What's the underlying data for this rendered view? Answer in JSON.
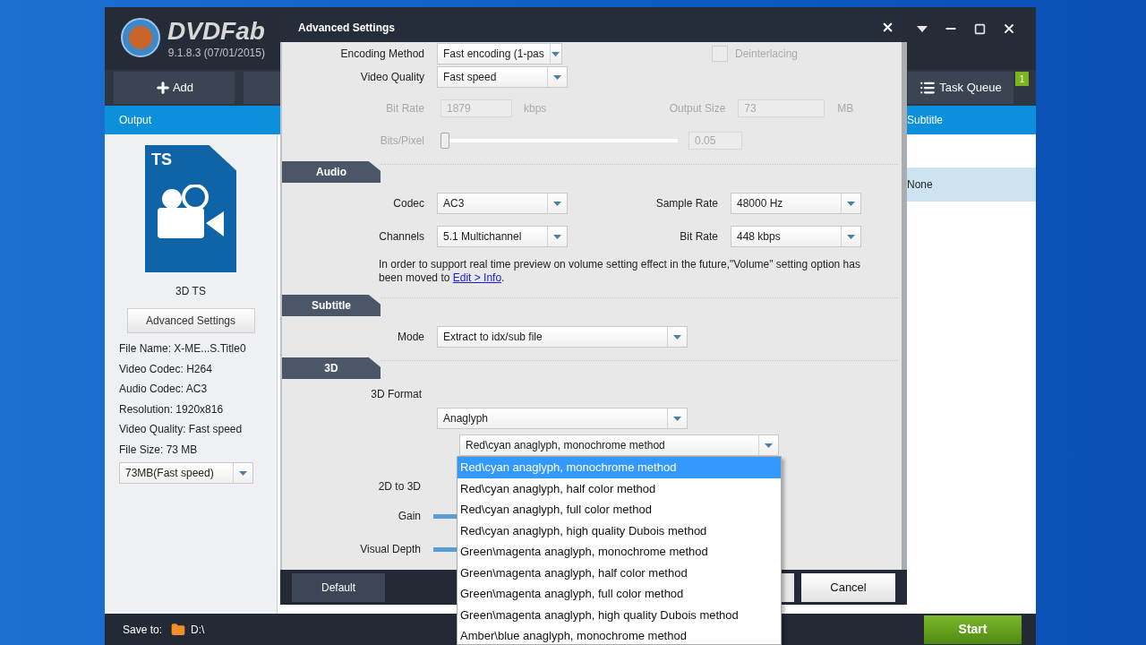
{
  "app": {
    "logo": "DVDFab",
    "version": "9.1.8.3 (07/01/2015)"
  },
  "toolbar": {
    "add_button": "Add",
    "task_queue": {
      "label": "Task Queue",
      "badge": "1"
    }
  },
  "header_bar": {
    "left": "Output",
    "right": "Subtitle"
  },
  "subtitle_rows": [
    {
      "text": "None",
      "selected": true
    }
  ],
  "output_panel": {
    "format_badge": "TS",
    "format_name": "3D TS",
    "advanced_button": "Advanced Settings",
    "info": [
      "File Name: X-ME...S.Title0",
      "Video Codec: H264",
      "Audio Codec: AC3",
      "Resolution: 1920x816",
      "Video Quality: Fast speed",
      "File Size: 73 MB"
    ],
    "size_select": "73MB(Fast speed)"
  },
  "bottom_bar": {
    "save_to_label": "Save to:",
    "path": "D:\\",
    "start_button": "Start"
  },
  "dialog": {
    "title": "Advanced Settings",
    "video": {
      "encoding_method": {
        "label": "Encoding Method",
        "value": "Fast encoding (1-pas"
      },
      "deinterlacing": {
        "label": "Deinterlacing",
        "checked": false,
        "disabled": true
      },
      "video_quality": {
        "label": "Video Quality",
        "value": "Fast speed"
      },
      "bit_rate": {
        "label": "Bit Rate",
        "value": "1879",
        "unit": "kbps",
        "disabled": true
      },
      "output_size": {
        "label": "Output Size",
        "value": "73",
        "unit": "MB",
        "disabled": true
      },
      "bits_pixel": {
        "label": "Bits/Pixel",
        "level": 0,
        "value": "0.05",
        "disabled": true
      }
    },
    "audio": {
      "title": "Audio",
      "codec": {
        "label": "Codec",
        "value": "AC3"
      },
      "sample_rate": {
        "label": "Sample Rate",
        "value": "48000 Hz"
      },
      "channels": {
        "label": "Channels",
        "value": "5.1 Multichannel"
      },
      "bit_rate": {
        "label": "Bit Rate",
        "value": "448 kbps"
      },
      "note": "In order to support real time preview on volume setting effect in the future,\"Volume\" setting option has been moved to ",
      "note_link": "Edit > Info",
      "note_end": "."
    },
    "subtitle": {
      "title": "Subtitle",
      "mode": {
        "label": "Mode",
        "value": "Extract to idx/sub file"
      }
    },
    "three_d": {
      "title": "3D",
      "format_label": "3D Format",
      "format_value": "Anaglyph",
      "method_value": "Red\\cyan anaglyph, monochrome method",
      "to_3d_label": "2D to 3D",
      "gain_label": "Gain",
      "depth_label": "Visual Depth"
    },
    "buttons": {
      "default": "Default",
      "cancel": "Cancel"
    }
  },
  "method_options": [
    {
      "label": "Red\\cyan anaglyph, monochrome method",
      "selected": true
    },
    {
      "label": "Red\\cyan anaglyph, half color method",
      "selected": false
    },
    {
      "label": "Red\\cyan anaglyph, full color method",
      "selected": false
    },
    {
      "label": "Red\\cyan anaglyph, high quality Dubois method",
      "selected": false
    },
    {
      "label": "Green\\magenta anaglyph, monochrome method",
      "selected": false
    },
    {
      "label": "Green\\magenta anaglyph, half color method",
      "selected": false
    },
    {
      "label": "Green\\magenta anaglyph, full color method",
      "selected": false
    },
    {
      "label": "Green\\magenta anaglyph, high quality Dubois method",
      "selected": false
    },
    {
      "label": "Amber\\blue anaglyph, monochrome method",
      "selected": false
    }
  ]
}
